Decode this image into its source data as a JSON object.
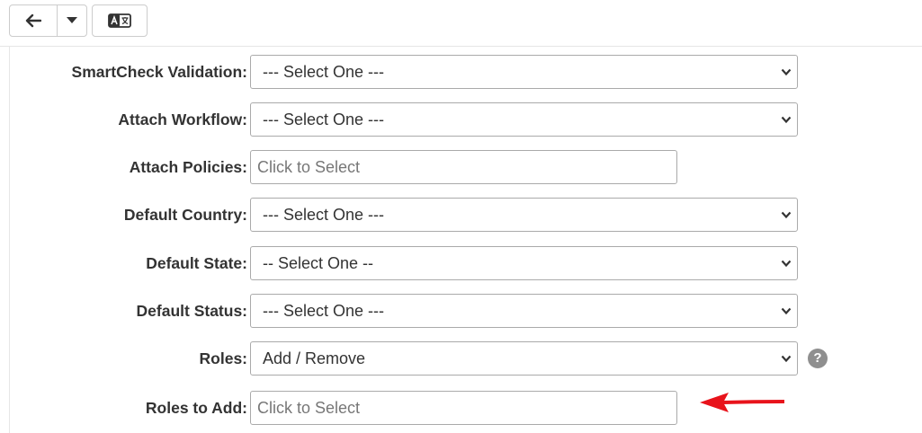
{
  "toolbar": {
    "back_icon": "arrow-left-icon",
    "dropdown_icon": "caret-down-icon",
    "translate_icon": "translate-icon"
  },
  "form": {
    "fields": [
      {
        "label": "SmartCheck Validation:",
        "type": "select",
        "value": "--- Select One ---"
      },
      {
        "label": "Attach Workflow:",
        "type": "select",
        "value": "--- Select One ---"
      },
      {
        "label": "Attach Policies:",
        "type": "input",
        "placeholder": "Click to Select"
      },
      {
        "label": "Default Country:",
        "type": "select",
        "value": "--- Select One ---"
      },
      {
        "label": "Default State:",
        "type": "select",
        "value": "-- Select One --"
      },
      {
        "label": "Default Status:",
        "type": "select",
        "value": "--- Select One ---"
      },
      {
        "label": "Roles:",
        "type": "select",
        "value": "Add / Remove",
        "help": "?"
      },
      {
        "label": "Roles to Add:",
        "type": "input",
        "placeholder": "Click to Select"
      }
    ]
  },
  "annotation": {
    "arrow_color": "#e8131b"
  }
}
